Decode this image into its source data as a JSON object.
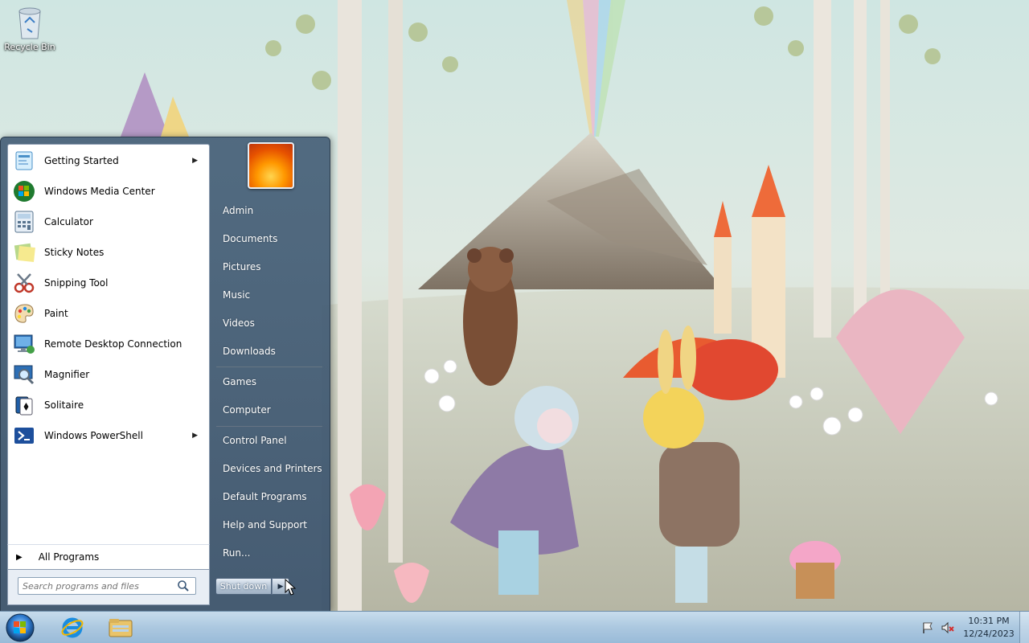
{
  "desktop": {
    "icons": [
      {
        "label": "Recycle Bin",
        "icon": "recycle-bin-icon"
      }
    ]
  },
  "start_menu": {
    "programs": [
      {
        "label": "Getting Started",
        "icon": "getting-started-icon",
        "has_submenu": true
      },
      {
        "label": "Windows Media Center",
        "icon": "windows-media-center-icon",
        "has_submenu": false
      },
      {
        "label": "Calculator",
        "icon": "calculator-icon",
        "has_submenu": false
      },
      {
        "label": "Sticky Notes",
        "icon": "sticky-notes-icon",
        "has_submenu": false
      },
      {
        "label": "Snipping Tool",
        "icon": "scissors-icon",
        "has_submenu": false
      },
      {
        "label": "Paint",
        "icon": "paint-palette-icon",
        "has_submenu": false
      },
      {
        "label": "Remote Desktop Connection",
        "icon": "remote-desktop-icon",
        "has_submenu": false
      },
      {
        "label": "Magnifier",
        "icon": "magnifier-icon",
        "has_submenu": false
      },
      {
        "label": "Solitaire",
        "icon": "solitaire-icon",
        "has_submenu": false
      },
      {
        "label": "Windows PowerShell",
        "icon": "powershell-icon",
        "has_submenu": true
      }
    ],
    "all_programs_label": "All Programs",
    "search": {
      "placeholder": "Search programs and files"
    },
    "user_name": "Admin",
    "places": [
      "Documents",
      "Pictures",
      "Music",
      "Videos",
      "Downloads"
    ],
    "places2": [
      "Games",
      "Computer"
    ],
    "system": [
      "Control Panel",
      "Devices and Printers",
      "Default Programs",
      "Help and Support",
      "Run..."
    ],
    "shutdown_label": "Shut down"
  },
  "taskbar": {
    "pinned": [
      {
        "name": "Internet Explorer",
        "icon": "internet-explorer-icon"
      },
      {
        "name": "Windows Explorer",
        "icon": "folder-icon"
      }
    ],
    "tray_icons": [
      "action-center-flag-icon",
      "volume-muted-icon"
    ],
    "clock": {
      "time": "10:31 PM",
      "date": "12/24/2023"
    }
  },
  "colors": {
    "start_menu_glass": "#3f5a76",
    "taskbar": "#a9c6e2"
  }
}
